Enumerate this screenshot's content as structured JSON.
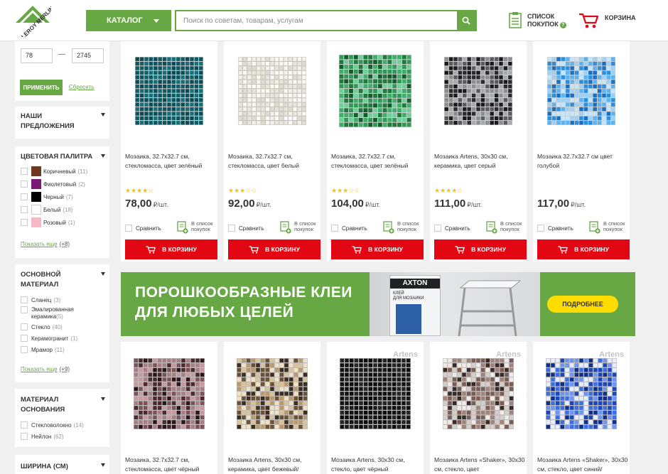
{
  "header": {
    "logo_text": "LEROY MERLIN",
    "catalog_label": "КАТАЛОГ",
    "search_placeholder": "Поиск по советам, товарам, услугам",
    "shopping_list_line1": "СПИСОК",
    "shopping_list_line2": "ПОКУПОК",
    "cart_label": "КОРЗИНА"
  },
  "sidebar": {
    "price_from": "78",
    "price_to": "2745",
    "apply_label": "ПРИМЕНИТЬ",
    "reset_label": "Сбросить",
    "offers_title": "НАШИ ПРЕДЛОЖЕНИЯ",
    "color_palette": {
      "title": "ЦВЕТОВАЯ ПАЛИТРА",
      "items": [
        {
          "label": "Коричневый",
          "count": "(11)",
          "color": "#6b3a1f"
        },
        {
          "label": "Фиолетовый",
          "count": "(2)",
          "color": "#7a1a78"
        },
        {
          "label": "Черный",
          "count": "(7)",
          "color": "#000000"
        },
        {
          "label": "Белый",
          "count": "(18)",
          "color": "#ffffff"
        },
        {
          "label": "Розовый",
          "count": "(1)",
          "color": "#f5b8c4"
        }
      ],
      "more_label": "Показать еще",
      "more_count": "(+8)"
    },
    "main_material": {
      "title": "ОСНОВНОЙ МАТЕРИАЛ",
      "items": [
        {
          "label": "Сланец",
          "count": "(3)"
        },
        {
          "label": "Эмалированная керамика",
          "count": "(5)"
        },
        {
          "label": "Стекло",
          "count": "(40)"
        },
        {
          "label": "Керамогранит",
          "count": "(1)"
        },
        {
          "label": "Мрамор",
          "count": "(11)"
        }
      ],
      "more_label": "Показать еще",
      "more_count": "(+9)"
    },
    "base_material": {
      "title": "МАТЕРИАЛ ОСНОВАНИЯ",
      "items": [
        {
          "label": "Стекловолокно",
          "count": "(14)"
        },
        {
          "label": "Нейлон",
          "count": "(62)"
        }
      ]
    },
    "width_title": "ШИРИНА (СМ)"
  },
  "product_common": {
    "compare_label": "Сравнить",
    "to_list_line1": "В список",
    "to_list_line2": "покупок",
    "buy_label": "В КОРЗИНУ",
    "unit": "₽/шт."
  },
  "products_row1": [
    {
      "name": "Мозаика, 32.7x32.7 см, стекломасса, цвет зелёный",
      "stars": "★★★★☆",
      "price": "78,00",
      "pattern": "teal"
    },
    {
      "name": "Мозаика, 32.7x32.7 см, стекломасса, цвет белый",
      "stars": "★★★☆☆",
      "price": "92,00",
      "pattern": "white"
    },
    {
      "name": "Мозаика, 32.7x32.7 см, стекломасса, цвет зелёный",
      "stars": "★★★☆☆",
      "price": "104,00",
      "pattern": "green"
    },
    {
      "name": "Мозаика Artens, 30x30 см, керамика, цвет серый",
      "stars": "★★★★☆",
      "price": "111,00",
      "pattern": "grey"
    },
    {
      "name": "Мозаика 32.7x32.7 см цвет голубой",
      "stars": "",
      "price": "117,00",
      "pattern": "blue"
    }
  ],
  "banner": {
    "line1": "ПОРОШКООБРАЗНЫЕ КЛЕИ",
    "line2": "ДЛЯ ЛЮБЫХ ЦЕЛЕЙ",
    "button_label": "ПОДРОБНЕЕ",
    "bucket_brand": "AXTON",
    "bucket_sub1": "КЛЕЙ",
    "bucket_sub2": "ДЛЯ МОЗАИКИ"
  },
  "products_row2": [
    {
      "name": "Мозаика, 32.7x32.7 см, стекломасса, цвет чёрный",
      "brand": "",
      "pattern": "mauve"
    },
    {
      "name": "Мозаика Artens, 30x30 см, керамика, цвет бежевый/",
      "brand": "",
      "pattern": "beige"
    },
    {
      "name": "Мозаика Artens, 30x30 см, стекло, цвет чёрный",
      "brand": "Artens",
      "pattern": "black"
    },
    {
      "name": "Мозаика Artens «Shaker», 30x30 см, стекло, цвет",
      "brand": "Artens",
      "pattern": "brownmix"
    },
    {
      "name": "Мозаика Artens «Shaker», 30x30 см, стекло, цвет синий/",
      "brand": "Artens",
      "pattern": "bluemix"
    }
  ],
  "palettes": {
    "teal": [
      "#0d5f66",
      "#0a5560",
      "#13707a",
      "#0b4b55"
    ],
    "white": [
      "#f2f0ea",
      "#e8e5dc",
      "#faf9f5",
      "#dedbd2"
    ],
    "green": [
      "#1f7a3c",
      "#2d9a55",
      "#6fcf9a",
      "#135c2c",
      "#3fae6b"
    ],
    "grey": [
      "#2b2b2d",
      "#5b5b5f",
      "#8d8e92",
      "#1a1a1b",
      "#a9aaae"
    ],
    "blue": [
      "#2b8fe0",
      "#5db3f0",
      "#9fd1f5",
      "#1a6fc2",
      "#c8e6fa"
    ],
    "mauve": [
      "#4a2a30",
      "#7a5258",
      "#a97e84",
      "#2a1518",
      "#c49aa0"
    ],
    "beige": [
      "#3b2d20",
      "#b89a6e",
      "#d9c39b",
      "#6a5238",
      "#efe2c6"
    ],
    "black": [
      "#0c0c0c",
      "#1a1a1a",
      "#262626",
      "#111111"
    ],
    "brownmix": [
      "#3a2a25",
      "#d6cfc9",
      "#7b5d55",
      "#f1ece8",
      "#a08479"
    ],
    "bluemix": [
      "#1d47b8",
      "#3e6fe0",
      "#0f2f8a",
      "#6f95ee",
      "#e8eefb"
    ]
  }
}
